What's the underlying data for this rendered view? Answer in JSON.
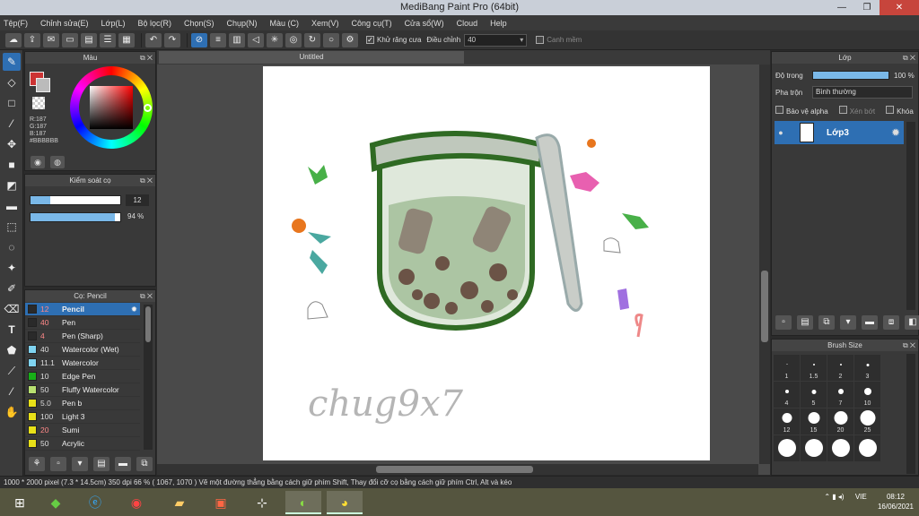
{
  "window": {
    "title": "MediBang Paint Pro (64bit)"
  },
  "menu": [
    "Tệp(F)",
    "Chỉnh sửa(E)",
    "Lớp(L)",
    "Bộ lọc(R)",
    "Chọn(S)",
    "Chụp(N)",
    "Màu (C)",
    "Xem(V)",
    "Công cụ(T)",
    "Cửa sổ(W)",
    "Cloud",
    "Help"
  ],
  "toolbar": {
    "antialias_label": "Khử răng cưa",
    "adjust_label": "Điều chỉnh",
    "adjust_value": "40",
    "edge_label": "Canh mềm"
  },
  "color_panel": {
    "title": "Màu",
    "r": "R:187",
    "g": "G:187",
    "b": "B:187",
    "hex": "#BBBBBB"
  },
  "brush_control": {
    "title": "Kiểm soát cọ",
    "size": "12",
    "opacity": "94 %",
    "opacity_level": 0.94
  },
  "brush_panel": {
    "title": "Cọ: Pencil",
    "items": [
      {
        "size": "12",
        "name": "Pencil",
        "color": "#2a2a2a"
      },
      {
        "size": "40",
        "name": "Pen",
        "color": "#2a2a2a"
      },
      {
        "size": "4",
        "name": "Pen (Sharp)",
        "color": "#2a2a2a"
      },
      {
        "size": "40",
        "name": "Watercolor (Wet)",
        "color": "#7fd3f0"
      },
      {
        "size": "11.1",
        "name": "Watercolor",
        "color": "#7fd3f0"
      },
      {
        "size": "10",
        "name": "Edge Pen",
        "color": "#18b018"
      },
      {
        "size": "50",
        "name": "Fluffy Watercolor",
        "color": "#b8e070"
      },
      {
        "size": "5.0",
        "name": "Pen b",
        "color": "#e8e018"
      },
      {
        "size": "100",
        "name": "Light 3",
        "color": "#e8e018"
      },
      {
        "size": "20",
        "name": "Sumi",
        "color": "#e8e018"
      },
      {
        "size": "50",
        "name": "Acrylic",
        "color": "#e8e018"
      }
    ]
  },
  "canvas": {
    "tab": "Untitled",
    "signature": "chug9x7"
  },
  "layer_panel": {
    "title": "Lớp",
    "opacity_label": "Độ trong",
    "opacity_value": "100 %",
    "opacity_level": 1.0,
    "blend_label": "Pha trộn",
    "blend_value": "Bình thường",
    "protect_alpha": "Bảo vệ alpha",
    "clip": "Xén bớt",
    "lock": "Khóa",
    "layer_name": "Lớp3"
  },
  "brush_size_panel": {
    "title": "Brush Size",
    "sizes": [
      "1",
      "1.5",
      "2",
      "3",
      "4",
      "5",
      "7",
      "10",
      "12",
      "15",
      "20",
      "25",
      "",
      "",
      "",
      ""
    ]
  },
  "statusbar": {
    "text": "1000 * 2000 pixel   (7.3 * 14.5cm)   350 dpi   66 %   ( 1067, 1070 )   Vẽ một đường thẳng bằng cách giữ phím Shift, Thay đổi cỡ cọ bằng cách giữ phím Ctrl, Alt và kéo"
  },
  "tray": {
    "lang": "VIE",
    "time": "08:12",
    "date": "16/06/2021"
  }
}
